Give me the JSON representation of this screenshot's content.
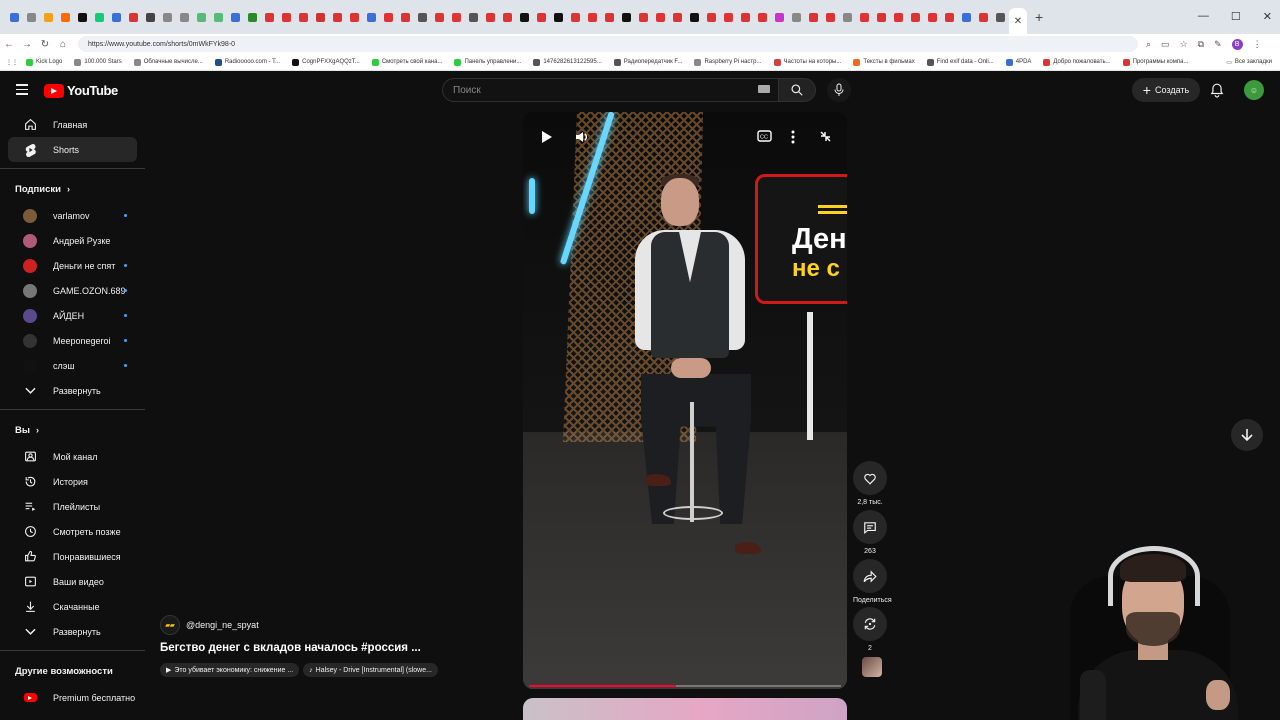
{
  "browser": {
    "url": "https://www.youtube.com/shorts/0mWkFYk98-0",
    "profile_initial": "B",
    "tab_favicon_colors": [
      "#3a6fd8",
      "#888",
      "#f4a11a",
      "#ff6a00",
      "#111",
      "#1c7",
      "#3a6fd8",
      "#d33",
      "#444",
      "#888",
      "#888",
      "#5b7",
      "#5b7",
      "#3a6fd8",
      "#2a8a2a",
      "#d33",
      "#d33",
      "#d33",
      "#c33",
      "#d33",
      "#d33",
      "#3a6fd8",
      "#d33",
      "#d33",
      "#555",
      "#d33",
      "#d33",
      "#555",
      "#d33",
      "#d33",
      "#111",
      "#d33",
      "#111",
      "#d33",
      "#d33",
      "#d33",
      "#111",
      "#d33",
      "#d33",
      "#d33",
      "#111",
      "#d33",
      "#d33",
      "#d33",
      "#d33",
      "#c3c",
      "#888",
      "#d33",
      "#d33",
      "#888",
      "#d33",
      "#d33",
      "#d33",
      "#d33",
      "#d33",
      "#d33",
      "#3a6fd8",
      "#d33",
      "#555"
    ],
    "bookmarks": [
      {
        "label": "Kick Logo",
        "color": "#2ecc40"
      },
      {
        "label": "100.000 Stars",
        "color": "#888"
      },
      {
        "label": "Облачные вычисле...",
        "color": "#888"
      },
      {
        "label": "Radiooooo.com - T...",
        "color": "#1f4f8a"
      },
      {
        "label": "CognPFXXgAQQzT...",
        "color": "#111"
      },
      {
        "label": "Смотреть свой кана...",
        "color": "#2ecc40"
      },
      {
        "label": "Панель управлени...",
        "color": "#2ecc40"
      },
      {
        "label": "1476282613122595...",
        "color": "#555"
      },
      {
        "label": "Радиопередатчик F...",
        "color": "#555"
      },
      {
        "label": "Raspberry Pi настр...",
        "color": "#888"
      },
      {
        "label": "Частоты на которы...",
        "color": "#c44"
      },
      {
        "label": "Тексты в фильмах",
        "color": "#f26b1d"
      },
      {
        "label": "Find exif data - Onli...",
        "color": "#555"
      },
      {
        "label": "4PDA",
        "color": "#3a6fd8"
      },
      {
        "label": "Добро пожаловать...",
        "color": "#d33"
      },
      {
        "label": "Программы компа...",
        "color": "#d33"
      }
    ],
    "bookmarks_all": "Все закладки"
  },
  "header": {
    "logo_text": "YouTube",
    "search_placeholder": "Поиск",
    "create_label": "Создать",
    "account_initial": "☺"
  },
  "sidebar": {
    "main": [
      {
        "label": "Главная",
        "icon": "home-icon"
      },
      {
        "label": "Shorts",
        "icon": "shorts-icon",
        "active": true
      }
    ],
    "subscriptions_title": "Подписки",
    "subscriptions": [
      {
        "label": "varlamov",
        "color": "#7a5c3a",
        "new": true
      },
      {
        "label": "Андрей Рузке",
        "color": "#b05a7a",
        "new": false
      },
      {
        "label": "Деньги не спят",
        "color": "#c22",
        "new": true
      },
      {
        "label": "GAME.OZON.689",
        "color": "#777",
        "new": true
      },
      {
        "label": "АЙДЕН",
        "color": "#5a4a8a",
        "new": true
      },
      {
        "label": "Meeponegeroi",
        "color": "#333",
        "new": true
      },
      {
        "label": "слэш",
        "color": "#111",
        "new": true
      }
    ],
    "expand_label": "Развернуть",
    "you_title": "Вы",
    "you": [
      {
        "label": "Мой канал",
        "icon": "channel-icon"
      },
      {
        "label": "История",
        "icon": "history-icon"
      },
      {
        "label": "Плейлисты",
        "icon": "playlists-icon"
      },
      {
        "label": "Смотреть позже",
        "icon": "watch-later-icon"
      },
      {
        "label": "Понравившиеся",
        "icon": "like-icon"
      },
      {
        "label": "Ваши видео",
        "icon": "your-videos-icon"
      },
      {
        "label": "Скачанные",
        "icon": "downloads-icon"
      }
    ],
    "expand_label_2": "Развернуть",
    "more_title": "Другие возможности",
    "premium_label": "Premium бесплатно"
  },
  "video": {
    "sign_line1": "Ден",
    "sign_line2": "не с",
    "progress_fraction": 0.47
  },
  "actions": {
    "likes": "2,8 тыс.",
    "comments": "263",
    "share": "Поделиться",
    "remix": "2"
  },
  "channel": {
    "handle": "@dengi_ne_spyat",
    "title": "Бегство денег с вкладов началось #россия ...",
    "chip_related": "Это убивает экономику: снижение ...",
    "chip_sound": "Halsey - Drive [Instrumental] (slowe..."
  }
}
